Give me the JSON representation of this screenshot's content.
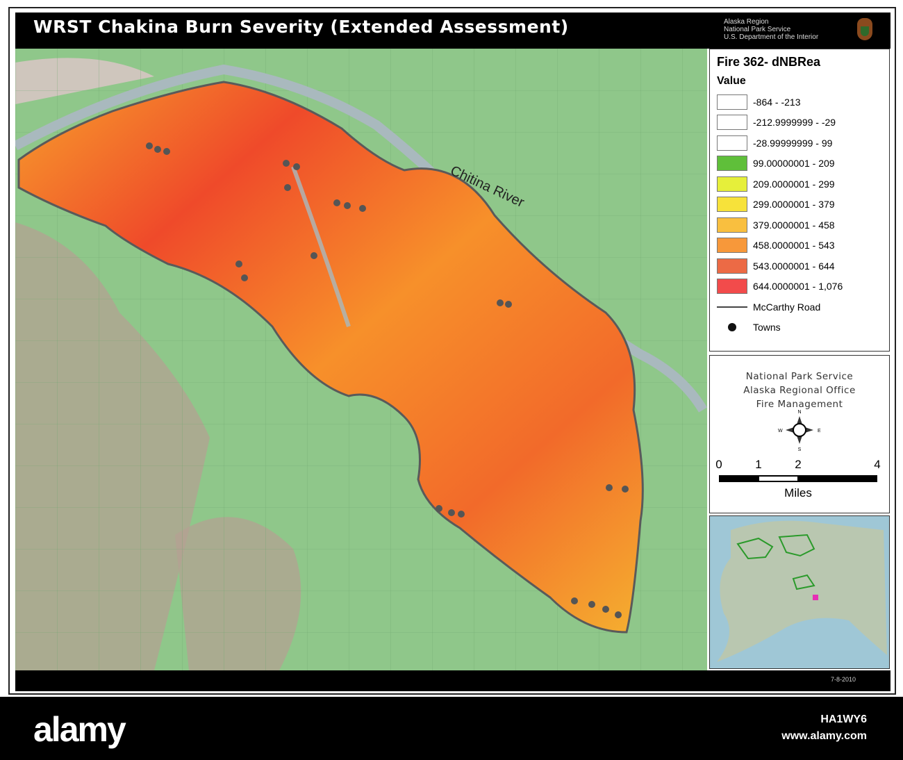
{
  "header": {
    "title": "WRST Chakina Burn Severity (Extended Assessment)",
    "agency": [
      "Alaska Region",
      "National Park Service",
      "U.S. Department of the Interior"
    ]
  },
  "map": {
    "river_label": "Chitina River",
    "colors": {
      "burn_high": "#f03a2a",
      "burn_mid": "#f79b2a",
      "burn_low": "#e8e536",
      "terrain": "#8fc78a",
      "river": "#a9b9be",
      "perimeter": "#5a5a5a",
      "town": "#555555"
    }
  },
  "legend": {
    "title": "Fire 362- dNBRea",
    "subtitle": "Value",
    "classes": [
      {
        "label": "-864 - -213",
        "color": "#ffffff"
      },
      {
        "label": "-212.9999999 - -29",
        "color": "#ffffff"
      },
      {
        "label": "-28.99999999 - 99",
        "color": "#ffffff"
      },
      {
        "label": "99.00000001 - 209",
        "color": "#5fbf3a"
      },
      {
        "label": "209.0000001 - 299",
        "color": "#e6ef3a"
      },
      {
        "label": "299.0000001 - 379",
        "color": "#f7e23a"
      },
      {
        "label": "379.0000001 - 458",
        "color": "#f9bf3f"
      },
      {
        "label": "458.0000001 - 543",
        "color": "#f7983a"
      },
      {
        "label": "543.0000001 - 644",
        "color": "#ec6a45"
      },
      {
        "label": "644.0000001 - 1,076",
        "color": "#f24b4b"
      }
    ],
    "road_label": "McCarthy Road",
    "towns_label": "Towns"
  },
  "info": {
    "org": [
      "National Park Service",
      "Alaska Regional Office",
      "Fire Management"
    ],
    "compass": {
      "n": "N",
      "s": "S",
      "e": "E",
      "w": "W"
    },
    "scale": {
      "ticks": [
        "0",
        "1",
        "2",
        "4"
      ],
      "unit": "Miles"
    }
  },
  "footer": {
    "date": "7-8-2010"
  },
  "watermark": {
    "logo": "alamy",
    "code": "HA1WY6",
    "url": "www.alamy.com"
  }
}
